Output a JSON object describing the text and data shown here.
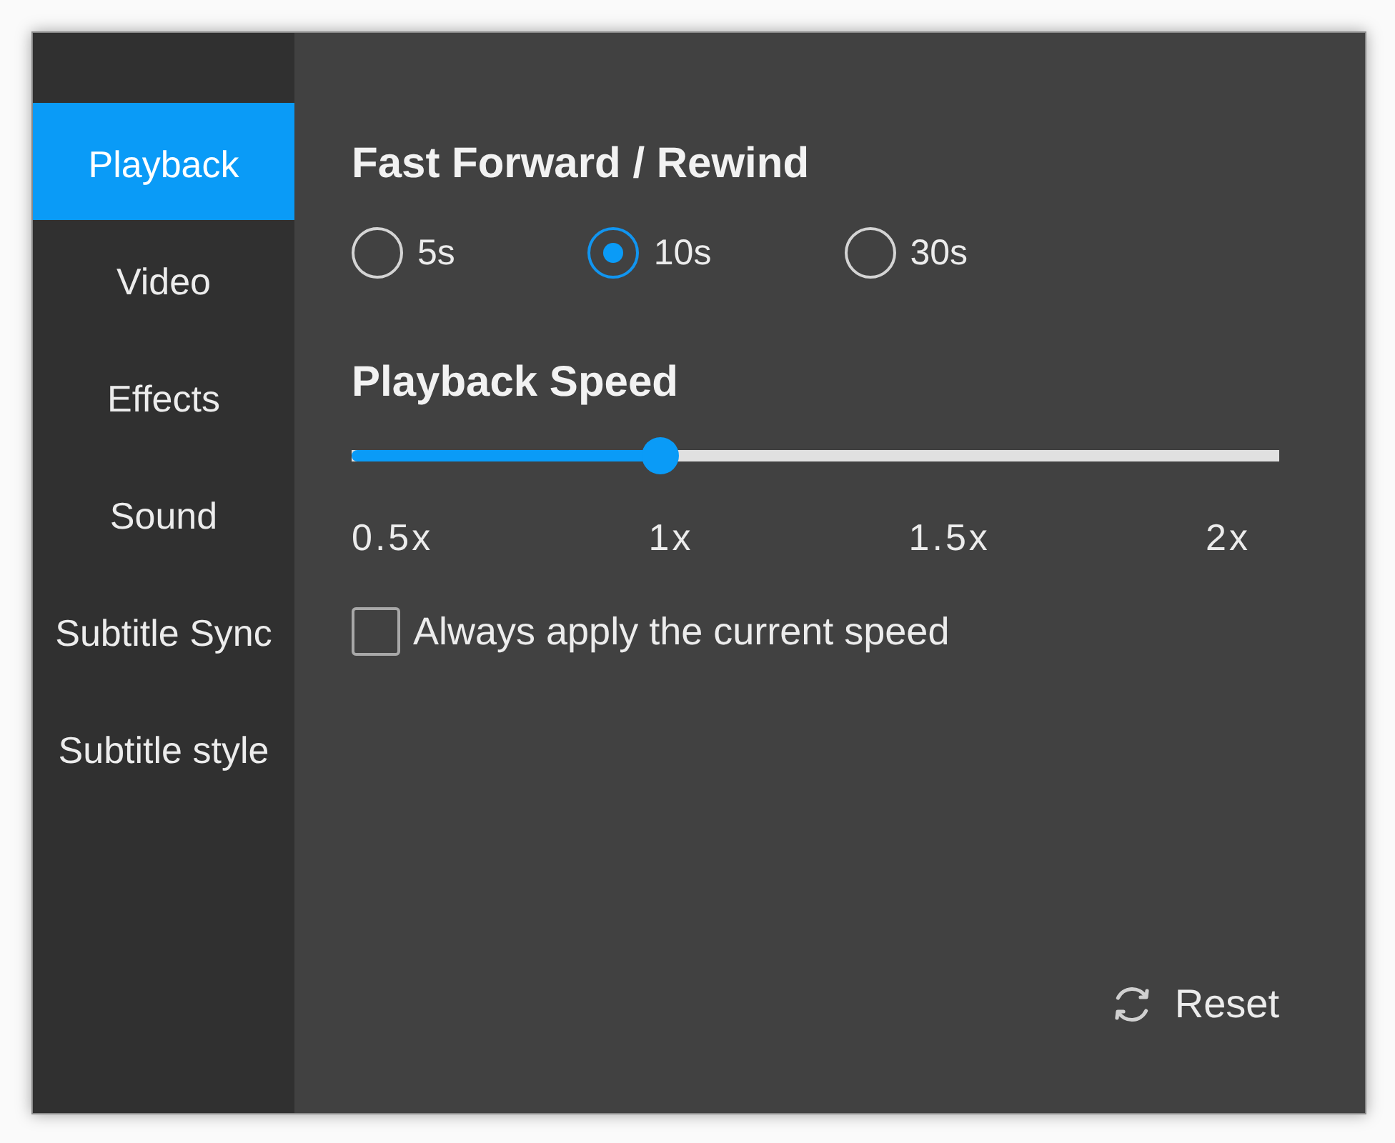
{
  "sidebar": {
    "items": [
      {
        "label": "Playback",
        "selected": true
      },
      {
        "label": "Video",
        "selected": false
      },
      {
        "label": "Effects",
        "selected": false
      },
      {
        "label": "Sound",
        "selected": false
      },
      {
        "label": "Subtitle Sync",
        "selected": false
      },
      {
        "label": "Subtitle style",
        "selected": false
      }
    ]
  },
  "fast_forward": {
    "title": "Fast Forward / Rewind",
    "options": [
      {
        "label": "5s",
        "selected": false
      },
      {
        "label": "10s",
        "selected": true
      },
      {
        "label": "30s",
        "selected": false
      }
    ]
  },
  "playback_speed": {
    "title": "Playback Speed",
    "slider": {
      "level": 0.333
    },
    "ticks": [
      "0.5x",
      "1x",
      "1.5x",
      "2x"
    ],
    "always_apply": {
      "label": "Always apply the current speed",
      "checked": false
    }
  },
  "reset_button": {
    "label": "Reset"
  }
}
